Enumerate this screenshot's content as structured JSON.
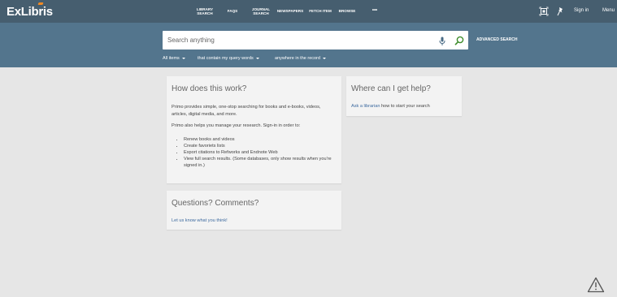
{
  "header": {
    "logo": "ExLibris",
    "nav": [
      {
        "label": "LIBRARY\nSEARCH"
      },
      {
        "label": "FAQS"
      },
      {
        "label": "JOURNAL\nSEARCH"
      },
      {
        "label": "NEWSPAPERS"
      },
      {
        "label": "FETCH ITEM"
      },
      {
        "label": "BROWSE"
      },
      {
        "label": "•••"
      }
    ],
    "sign_in": "Sign in",
    "menu": "Menu"
  },
  "search": {
    "placeholder": "Search anything",
    "advanced": "ADVANCED SEARCH",
    "filter_scope": "All items",
    "filter_match": "that contain my query words",
    "filter_field": "anywhere in the record"
  },
  "how_card": {
    "title": "How does this work?",
    "para1": "Primo provides simple, one-stop searching for books and e-books, videos, articles, digital media, and more.",
    "para2": "Primo also helps you manage your research. Sign-in in order to:",
    "items": [
      "Renew books and videos",
      "Create favoriets lists",
      "Export citations to Refworks and Endnote Web",
      "View full search results. (Some databases, only show results when you're signed in.)"
    ]
  },
  "help_card": {
    "title": "Where can I get help?",
    "link": "Ask a librarian",
    "rest": " how to start your search"
  },
  "questions_card": {
    "title": "Questions? Comments?",
    "link": "Let us know what you think!"
  },
  "colors": {
    "topbar": "#465e6f",
    "searchband": "#53758d",
    "background": "#e6e6e6",
    "link": "#3d6a9f",
    "search_icon": "#3d8c2a"
  }
}
